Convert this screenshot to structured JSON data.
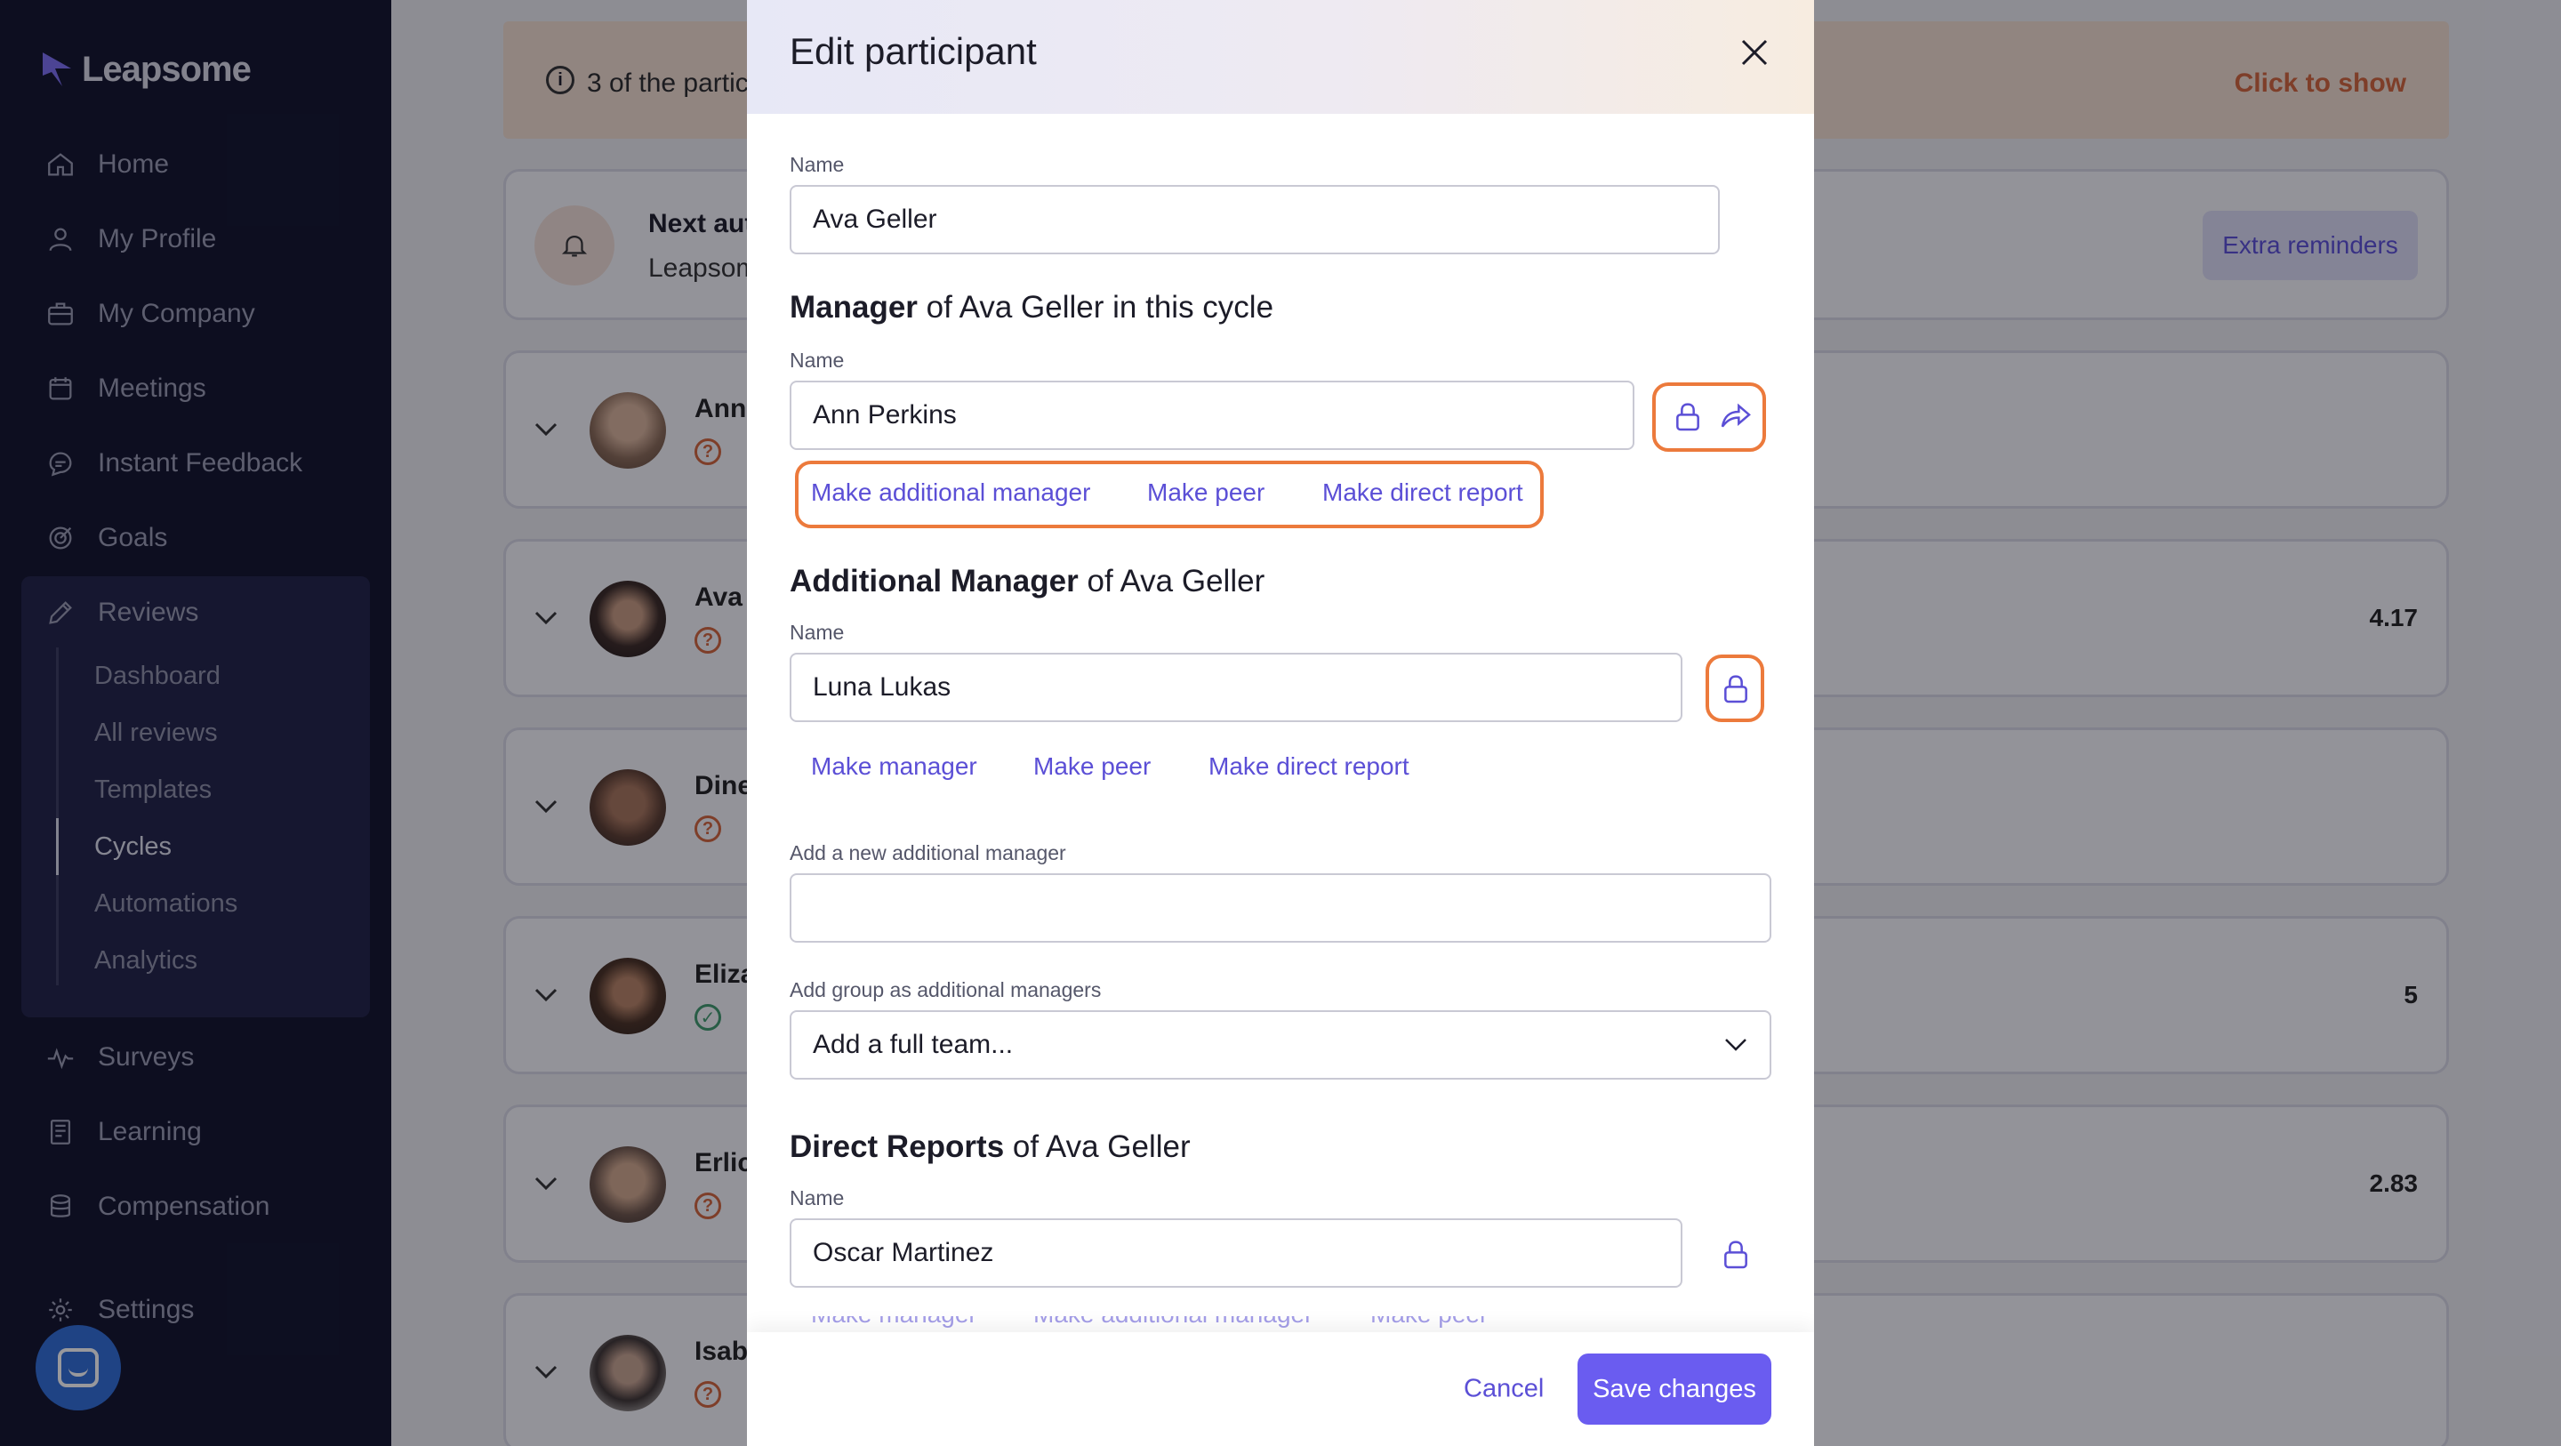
{
  "brand": {
    "name": "Leapsome"
  },
  "sidebar": {
    "items": [
      {
        "label": "Home",
        "icon": "home-icon"
      },
      {
        "label": "My Profile",
        "icon": "user-icon"
      },
      {
        "label": "My Company",
        "icon": "briefcase-icon"
      },
      {
        "label": "Meetings",
        "icon": "calendar-icon"
      },
      {
        "label": "Instant Feedback",
        "icon": "chat-icon"
      },
      {
        "label": "Goals",
        "icon": "target-icon"
      },
      {
        "label": "Reviews",
        "icon": "pencil-icon"
      },
      {
        "label": "Surveys",
        "icon": "pulse-icon"
      },
      {
        "label": "Learning",
        "icon": "book-icon"
      },
      {
        "label": "Compensation",
        "icon": "coins-icon"
      },
      {
        "label": "Settings",
        "icon": "gear-icon"
      }
    ],
    "reviews_sub": [
      "Dashboard",
      "All reviews",
      "Templates",
      "Cycles",
      "Automations",
      "Analytics"
    ],
    "active_sub": "Cycles"
  },
  "background": {
    "banner": {
      "text": "3 of the partic",
      "action": "Click to show"
    },
    "reminder": {
      "title": "Next aut",
      "subtitle": "Leapsom",
      "button": "Extra reminders"
    },
    "rows": [
      {
        "name": "Ann",
        "status_icon": "?",
        "score": ""
      },
      {
        "name": "Ava",
        "status_icon": "?",
        "score": "4.17"
      },
      {
        "name": "Dine",
        "status_icon": "?",
        "score": ""
      },
      {
        "name": "Eliza",
        "status_icon": "✓",
        "score": "5"
      },
      {
        "name": "Erlic",
        "status_icon": "?",
        "score": "2.83"
      },
      {
        "name": "Isab",
        "status_icon": "?",
        "score": ""
      }
    ]
  },
  "modal": {
    "title": "Edit participant",
    "name_label": "Name",
    "name_value": "Ava Geller",
    "manager": {
      "heading_bold": "Manager",
      "heading_rest": " of Ava Geller in this cycle",
      "label": "Name",
      "value": "Ann Perkins",
      "actions": [
        "Make additional manager",
        "Make peer",
        "Make direct report"
      ]
    },
    "additional_manager": {
      "heading_bold": "Additional Manager",
      "heading_rest": " of Ava Geller",
      "label": "Name",
      "value": "Luna Lukas",
      "actions": [
        "Make manager",
        "Make peer",
        "Make direct report"
      ],
      "new_label": "Add a new additional manager",
      "new_value": "",
      "group_label": "Add group as additional managers",
      "group_value": "Add a full team..."
    },
    "direct_reports": {
      "heading_bold": "Direct Reports",
      "heading_rest": " of Ava Geller",
      "label": "Name",
      "value": "Oscar Martinez",
      "actions": [
        "Make manager",
        "Make additional manager",
        "Make peer"
      ]
    },
    "cancel": "Cancel",
    "save": "Save changes"
  },
  "colors": {
    "accent": "#6a5cf0",
    "highlight": "#ec7a3c",
    "sidebar": "#10122a"
  }
}
